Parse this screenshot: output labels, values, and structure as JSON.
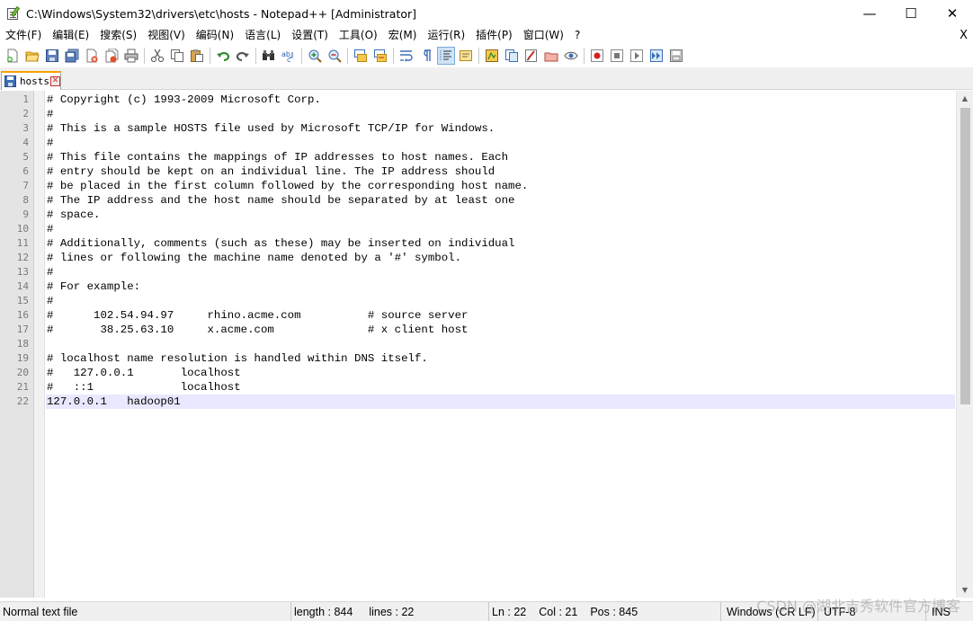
{
  "window": {
    "title": "C:\\Windows\\System32\\drivers\\etc\\hosts - Notepad++ [Administrator]",
    "minimize": "—",
    "maximize": "☐",
    "close": "✕"
  },
  "menu": {
    "items": [
      "文件(F)",
      "编辑(E)",
      "搜索(S)",
      "视图(V)",
      "编码(N)",
      "语言(L)",
      "设置(T)",
      "工具(O)",
      "宏(M)",
      "运行(R)",
      "插件(P)",
      "窗口(W)",
      "?"
    ],
    "close": "X"
  },
  "toolbar": {
    "icons": [
      "new-file-icon",
      "open-file-icon",
      "save-icon",
      "save-all-icon",
      "close-icon",
      "close-all-icon",
      "print-icon",
      "cut-icon",
      "copy-icon",
      "paste-icon",
      "undo-icon",
      "redo-icon",
      "find-icon",
      "replace-icon",
      "zoom-in-icon",
      "zoom-out-icon",
      "sync-vertical-icon",
      "sync-horizontal-icon",
      "word-wrap-icon",
      "show-all-chars-icon",
      "indent-guide-icon",
      "user-language-icon",
      "document-map-icon",
      "function-list-icon",
      "folder-workspace-icon",
      "monitoring-icon",
      "record-macro-icon",
      "stop-record-icon",
      "playback-icon",
      "run-macro-multiple-icon",
      "save-macro-icon"
    ]
  },
  "tab": {
    "label": "hosts",
    "close": "✕"
  },
  "editor": {
    "current_line": 22,
    "lines": [
      "# Copyright (c) 1993-2009 Microsoft Corp.",
      "#",
      "# This is a sample HOSTS file used by Microsoft TCP/IP for Windows.",
      "#",
      "# This file contains the mappings of IP addresses to host names. Each",
      "# entry should be kept on an individual line. The IP address should",
      "# be placed in the first column followed by the corresponding host name.",
      "# The IP address and the host name should be separated by at least one",
      "# space.",
      "#",
      "# Additionally, comments (such as these) may be inserted on individual",
      "# lines or following the machine name denoted by a '#' symbol.",
      "#",
      "# For example:",
      "#",
      "#      102.54.94.97     rhino.acme.com          # source server",
      "#       38.25.63.10     x.acme.com              # x client host",
      "",
      "# localhost name resolution is handled within DNS itself.",
      "#   127.0.0.1       localhost",
      "#   ::1             localhost",
      "127.0.0.1   hadoop01"
    ]
  },
  "status": {
    "file_type": "Normal text file",
    "length": "length : 844",
    "lines": "lines : 22",
    "ln": "Ln : 22",
    "col": "Col : 21",
    "pos": "Pos : 845",
    "eol": "Windows (CR LF)",
    "encoding": "UTF-8",
    "mode": "INS"
  },
  "watermark": "CSDN @湖北吉秀软件官方博客"
}
